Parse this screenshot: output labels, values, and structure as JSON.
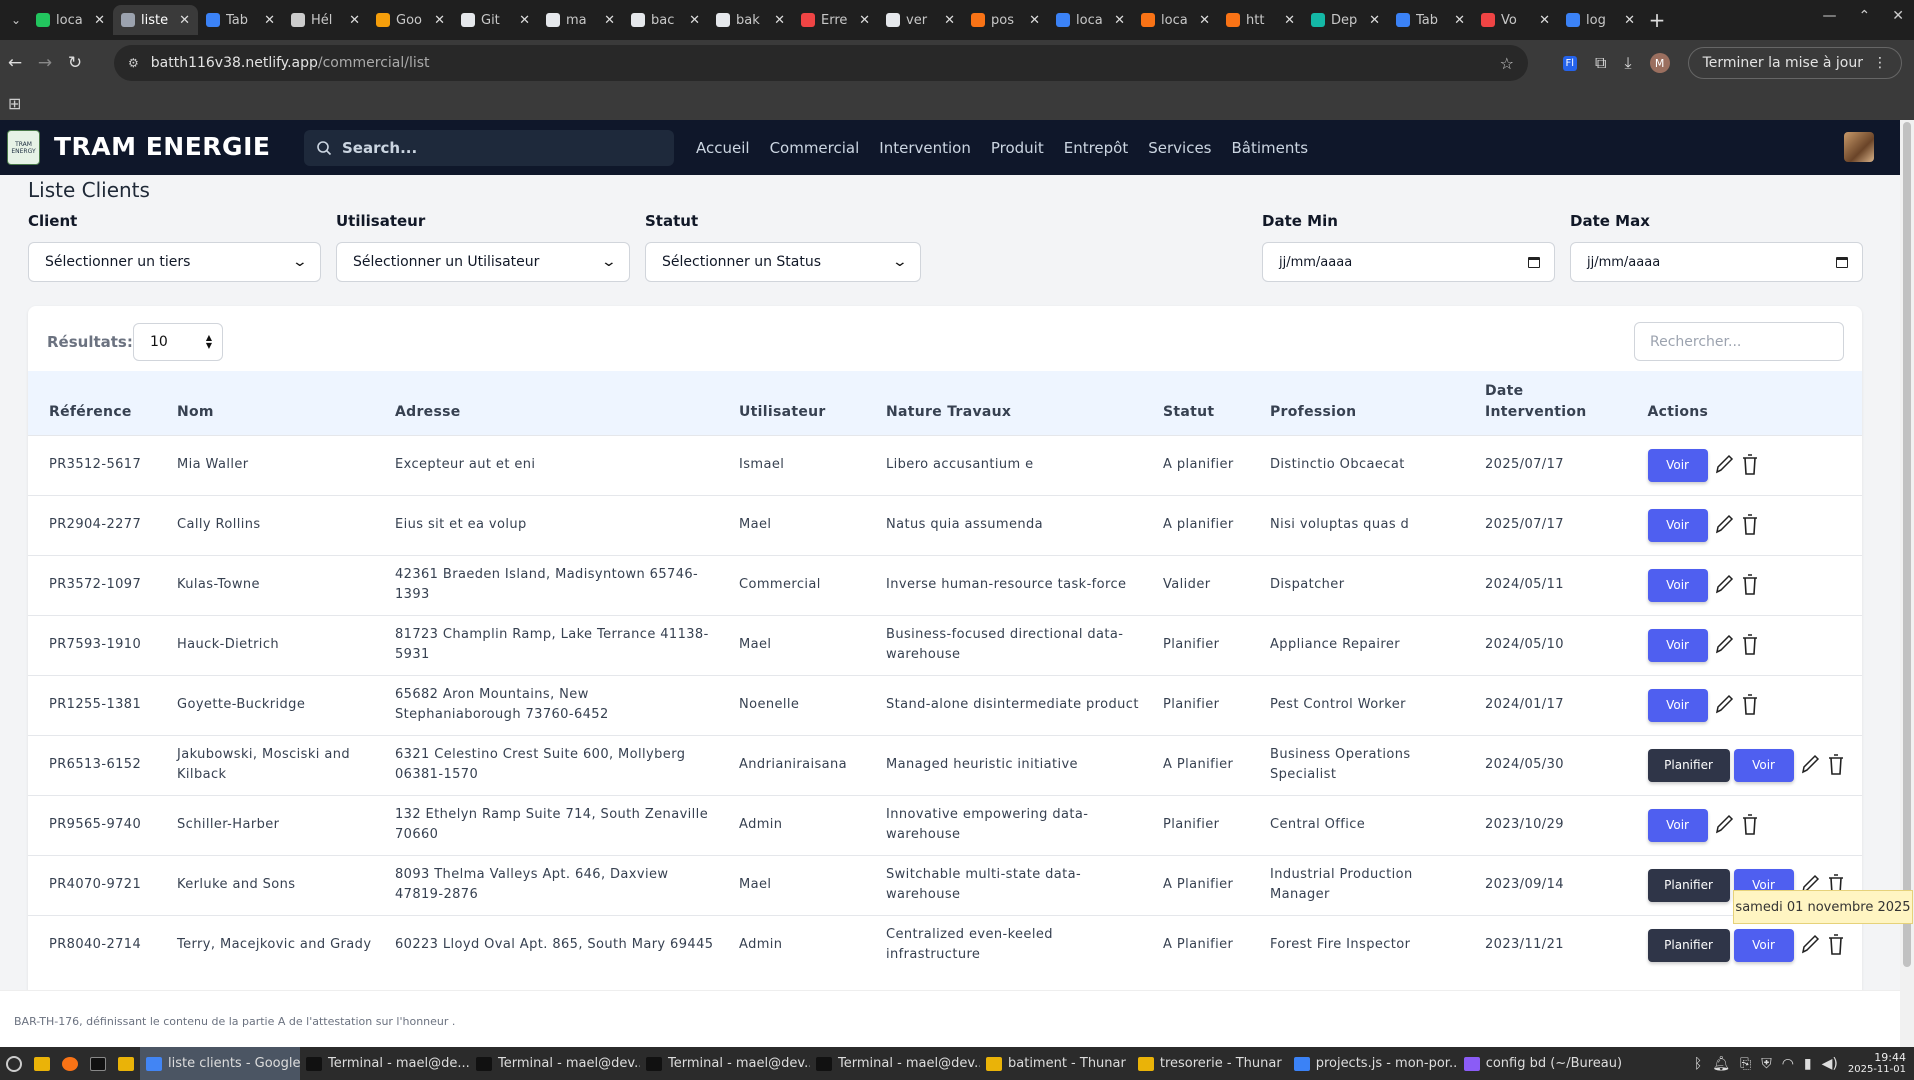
{
  "browser": {
    "tabs": [
      {
        "label": "loca",
        "color": "#22c55e"
      },
      {
        "label": "liste",
        "color": "#9ca3af",
        "active": true
      },
      {
        "label": "Tab",
        "color": "#3b82f6"
      },
      {
        "label": "Hél",
        "color": "#cccccc"
      },
      {
        "label": "Goo",
        "color": "#f59e0b"
      },
      {
        "label": "Git",
        "color": "#e5e7eb"
      },
      {
        "label": "ma",
        "color": "#e5e7eb"
      },
      {
        "label": "bac",
        "color": "#e5e7eb"
      },
      {
        "label": "bak",
        "color": "#e5e7eb"
      },
      {
        "label": "Erre",
        "color": "#ef4444"
      },
      {
        "label": "ver",
        "color": "#e5e7eb"
      },
      {
        "label": "pos",
        "color": "#f97316"
      },
      {
        "label": "loca",
        "color": "#3b82f6"
      },
      {
        "label": "loca",
        "color": "#f97316"
      },
      {
        "label": "htt",
        "color": "#f97316"
      },
      {
        "label": "Dep",
        "color": "#14b8a6"
      },
      {
        "label": "Tab",
        "color": "#3b82f6"
      },
      {
        "label": "Vo",
        "color": "#ef4444"
      },
      {
        "label": "log",
        "color": "#3b82f6"
      }
    ],
    "url_host": "batth116v38.netlify.app",
    "url_path": "/commercial/list",
    "update_label": "Terminer la mise à jour",
    "profile_initial": "M"
  },
  "app": {
    "brand": "TRAM ENERGIE",
    "logo_text": "TRAM ENERGY",
    "search_placeholder": "Search...",
    "nav": [
      "Accueil",
      "Commercial",
      "Intervention",
      "Produit",
      "Entrepôt",
      "Services",
      "Bâtiments"
    ]
  },
  "page": {
    "title": "Liste Clients",
    "filters": {
      "client_label": "Client",
      "client_value": "Sélectionner un tiers",
      "user_label": "Utilisateur",
      "user_value": "Sélectionner un Utilisateur",
      "status_label": "Statut",
      "status_value": "Sélectionner un Status",
      "date_min_label": "Date Min",
      "date_min_value": "jj/mm/aaaa",
      "date_max_label": "Date Max",
      "date_max_value": "jj/mm/aaaa"
    },
    "results_label": "Résultats:",
    "results_value": "10",
    "table_search_placeholder": "Rechercher...",
    "columns": [
      "Référence",
      "Nom",
      "Adresse",
      "Utilisateur",
      "Nature Travaux",
      "Statut",
      "Profession",
      "Date Intervention",
      "Actions"
    ],
    "voir_label": "Voir",
    "planifier_label": "Planifier",
    "rows": [
      {
        "ref": "PR3512-5617",
        "nom": "Mia Waller",
        "adresse": "Excepteur aut et eni",
        "user": "Ismael",
        "nature": "Libero accusantium e",
        "statut": "A planifier",
        "profession": "Distinctio Obcaecat",
        "date": "2025/07/17",
        "planifier": false
      },
      {
        "ref": "PR2904-2277",
        "nom": "Cally Rollins",
        "adresse": "Eius sit et ea volup",
        "user": "Mael",
        "nature": "Natus quia assumenda",
        "statut": "A planifier",
        "profession": "Nisi voluptas quas d",
        "date": "2025/07/17",
        "planifier": false
      },
      {
        "ref": "PR3572-1097",
        "nom": "Kulas-Towne",
        "adresse": "42361 Braeden Island, Madisyntown 65746-1393",
        "user": "Commercial",
        "nature": "Inverse human-resource task-force",
        "statut": "Valider",
        "profession": "Dispatcher",
        "date": "2024/05/11",
        "planifier": false
      },
      {
        "ref": "PR7593-1910",
        "nom": "Hauck-Dietrich",
        "adresse": "81723 Champlin Ramp, Lake Terrance 41138-5931",
        "user": "Mael",
        "nature": "Business-focused directional data-warehouse",
        "statut": "Planifier",
        "profession": "Appliance Repairer",
        "date": "2024/05/10",
        "planifier": false
      },
      {
        "ref": "PR1255-1381",
        "nom": "Goyette-Buckridge",
        "adresse": "65682 Aron Mountains, New Stephaniaborough 73760-6452",
        "user": "Noenelle",
        "nature": "Stand-alone disintermediate product",
        "statut": "Planifier",
        "profession": "Pest Control Worker",
        "date": "2024/01/17",
        "planifier": false
      },
      {
        "ref": "PR6513-6152",
        "nom": "Jakubowski, Mosciski and Kilback",
        "adresse": "6321 Celestino Crest Suite 600, Mollyberg 06381-1570",
        "user": "Andrianiraisana",
        "nature": "Managed heuristic initiative",
        "statut": "A Planifier",
        "profession": "Business Operations Specialist",
        "date": "2024/05/30",
        "planifier": true
      },
      {
        "ref": "PR9565-9740",
        "nom": "Schiller-Harber",
        "adresse": "132 Ethelyn Ramp Suite 714, South Zenaville 70660",
        "user": "Admin",
        "nature": "Innovative empowering data-warehouse",
        "statut": "Planifier",
        "profession": "Central Office",
        "date": "2023/10/29",
        "planifier": false
      },
      {
        "ref": "PR4070-9721",
        "nom": "Kerluke and Sons",
        "adresse": "8093 Thelma Valleys Apt. 646, Daxview 47819-2876",
        "user": "Mael",
        "nature": "Switchable multi-state data-warehouse",
        "statut": "A Planifier",
        "profession": "Industrial Production Manager",
        "date": "2023/09/14",
        "planifier": true
      },
      {
        "ref": "PR8040-2714",
        "nom": "Terry, Macejkovic and Grady",
        "adresse": "60223 Lloyd Oval Apt. 865, South Mary 69445",
        "user": "Admin",
        "nature": "Centralized even-keeled infrastructure",
        "statut": "A Planifier",
        "profession": "Forest Fire Inspector",
        "date": "2023/11/21",
        "planifier": true
      }
    ],
    "footer_text": "BAR-TH-176, définissant le contenu de la partie A de l'attestation sur l'honneur .",
    "date_badge": "samedi 01 novembre 2025"
  },
  "taskbar": {
    "apps": [
      {
        "label": "liste clients - Google ...",
        "color": "#4285f4",
        "active": true
      },
      {
        "label": "Terminal - mael@de...",
        "color": "#111111"
      },
      {
        "label": "Terminal - mael@dev...",
        "color": "#111111"
      },
      {
        "label": "Terminal - mael@dev...",
        "color": "#111111"
      },
      {
        "label": "Terminal - mael@dev...",
        "color": "#111111"
      },
      {
        "label": "batiment - Thunar",
        "color": "#eab308"
      },
      {
        "label": "tresorerie - Thunar",
        "color": "#eab308"
      },
      {
        "label": "projects.js - mon-por...",
        "color": "#3b82f6"
      },
      {
        "label": "config bd (~/Bureau)",
        "color": "#8b5cf6"
      }
    ],
    "time": "19:44",
    "date": "2025-11-01"
  }
}
